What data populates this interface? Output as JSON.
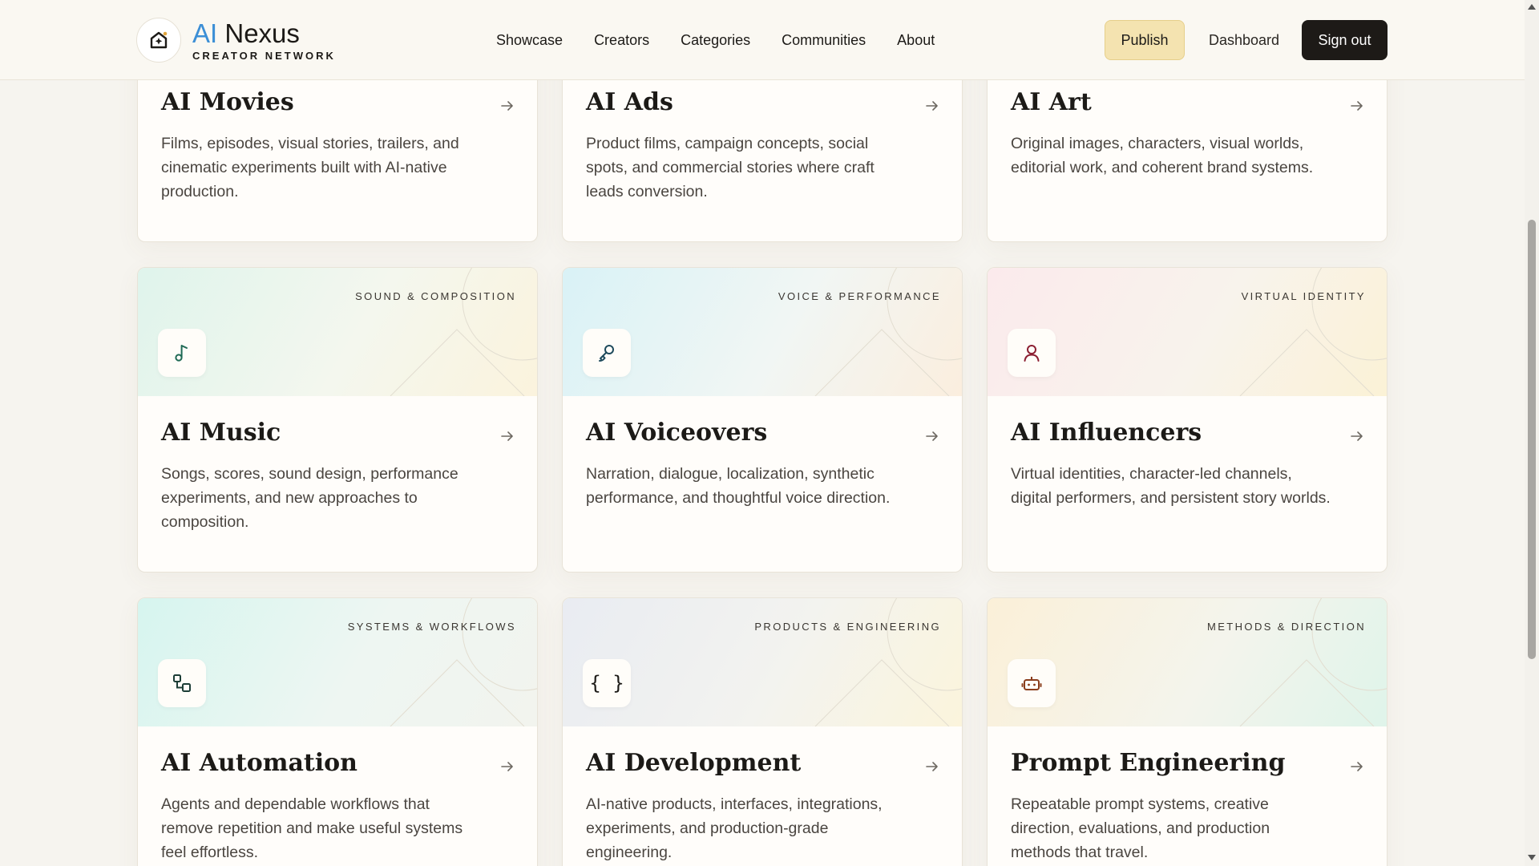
{
  "brand": {
    "ai": "AI",
    "name": "Nexus",
    "subtitle": "CREATOR NETWORK"
  },
  "nav": [
    "Showcase",
    "Creators",
    "Categories",
    "Communities",
    "About"
  ],
  "actions": {
    "publish": "Publish",
    "dashboard": "Dashboard",
    "signout": "Sign out"
  },
  "colors": {
    "accent": "#3c8fd6",
    "publish_bg": "#f4e3b0",
    "signout_bg": "#1d1a17"
  },
  "cards": [
    {
      "title": "AI Movies",
      "tag": "",
      "icon": "",
      "desc": "Films, episodes, visual stories, trailers, and cinematic experiments built with AI-native production."
    },
    {
      "title": "AI Ads",
      "tag": "",
      "icon": "",
      "desc": "Product films, campaign concepts, social spots, and commercial stories where craft leads conversion."
    },
    {
      "title": "AI Art",
      "tag": "",
      "icon": "",
      "desc": "Original images, characters, visual worlds, editorial work, and coherent brand systems."
    },
    {
      "title": "AI Music",
      "tag": "SOUND & COMPOSITION",
      "icon": "music-note-icon",
      "desc": "Songs, scores, sound design, performance experiments, and new approaches to composition."
    },
    {
      "title": "AI Voiceovers",
      "tag": "VOICE & PERFORMANCE",
      "icon": "microphone-icon",
      "desc": "Narration, dialogue, localization, synthetic performance, and thoughtful voice direction."
    },
    {
      "title": "AI Influencers",
      "tag": "VIRTUAL IDENTITY",
      "icon": "user-icon",
      "desc": "Virtual identities, character-led channels, digital performers, and persistent story worlds."
    },
    {
      "title": "AI Automation",
      "tag": "SYSTEMS & WORKFLOWS",
      "icon": "workflow-icon",
      "desc": "Agents and dependable workflows that remove repetition and make useful systems feel effortless."
    },
    {
      "title": "AI Development",
      "tag": "PRODUCTS & ENGINEERING",
      "icon": "code-braces-icon",
      "desc": "AI-native products, interfaces, integrations, experiments, and production-grade engineering."
    },
    {
      "title": "Prompt Engineering",
      "tag": "METHODS & DIRECTION",
      "icon": "robot-icon",
      "desc": "Repeatable prompt systems, creative direction, evaluations, and production methods that travel."
    }
  ]
}
